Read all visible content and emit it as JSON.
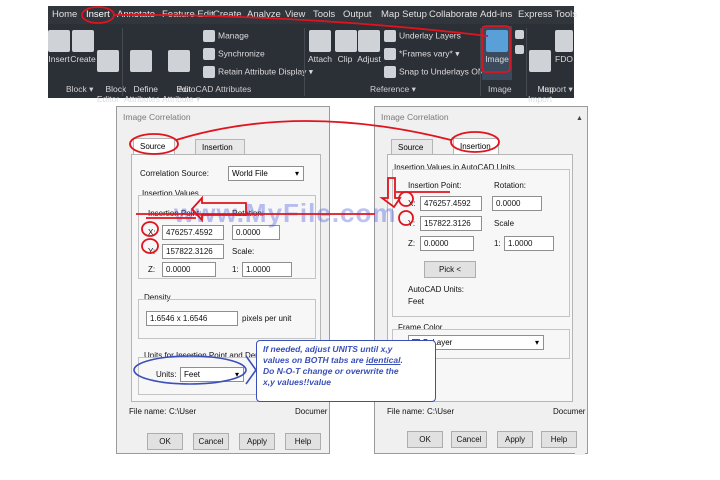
{
  "ribbon": {
    "tabs": [
      "Home",
      "Insert",
      "Annotate",
      "Feature Edit",
      "Create",
      "Analyze",
      "View",
      "Tools",
      "Output",
      "Map Setup",
      "Collaborate",
      "Add-ins",
      "Express Tools"
    ],
    "active_tab": "Insert",
    "block_tools": [
      "Insert",
      "Create",
      "Block\nEditor"
    ],
    "block_panel": "Block ▾",
    "define_attributes": "Define\nAttributes",
    "edit_attribute": "Edit\nAttribute ▾",
    "manage": "Manage",
    "synchronize": "Synchronize",
    "retain_attribute_display": "Retain Attribute Display ▾",
    "autocad_attributes_panel": "AutoCAD Attributes",
    "attach": "Attach",
    "clip": "Clip",
    "adjust": "Adjust",
    "underlay_layers": "Underlay Layers",
    "frames_vary": "*Frames vary* ▾",
    "snap_to_underlays": "Snap to Underlays ON ▾",
    "reference_panel": "Reference ▾",
    "image_button": "Image",
    "image_panel": "Image",
    "map_import": "Map\nImport",
    "fdo": "FDO",
    "import_panel": "Import ▾"
  },
  "left_dialog": {
    "title": "Image Correlation",
    "tabs": [
      "Source",
      "Insertion"
    ],
    "selected_tab": "Source",
    "correlation_source_label": "Correlation Source:",
    "correlation_source_value": "World File",
    "insertion_values_label": "Insertion Values",
    "insertion_point_label": "Insertion Point:",
    "rotation_label": "Rotation:",
    "x_label": "X:",
    "x_value": "476257.4592",
    "y_label": "Y:",
    "y_value": "157822.3126",
    "z_label": "Z:",
    "z_value": "0.0000",
    "rotation_value": "0.0000",
    "scale_label": "Scale:",
    "scale_prefix": "1:",
    "scale_value": "1.0000",
    "density_label": "Density",
    "density_value": "1.6546 x 1.6546",
    "density_units": "pixels per unit",
    "units_group_label": "Units for Insertion Point and Density",
    "units_label": "Units:",
    "units_value": "Feet",
    "file_name_label": "File name:",
    "file_name_value": "C:\\User",
    "file_name_tail": "Documer",
    "ok": "OK",
    "cancel": "Cancel",
    "apply": "Apply",
    "help": "Help"
  },
  "right_dialog": {
    "title": "Image Correlation",
    "tabs": [
      "Source",
      "Insertion"
    ],
    "selected_tab": "Insertion",
    "insertion_values_label": "Insertion Values in AutoCAD Units",
    "insertion_point_label": "Insertion Point:",
    "rotation_label": "Rotation:",
    "x_label": "X:",
    "x_value": "476257.4592",
    "rotation_value": "0.0000",
    "y_label": "Y:",
    "y_value": "157822.3126",
    "scale_label": "Scale",
    "z_label": "Z:",
    "z_value": "0.0000",
    "scale_prefix": "1:",
    "scale_value": "1.0000",
    "pick_button": "Pick <",
    "autocad_units_label": "AutoCAD Units:",
    "autocad_units_value": "Feet",
    "frame_color_label": "Frame Color",
    "frame_color_value": "ByLayer",
    "file_name_label": "File name:",
    "file_name_value": "C:\\User",
    "file_name_tail": "Documer",
    "ok": "OK",
    "cancel": "Cancel",
    "apply": "Apply",
    "help": "Help"
  },
  "note": {
    "line1": "If needed, adjust UNITS until x,y",
    "line2_a": "values on BOTH tabs are ",
    "line2_b": "identical",
    "line2_c": ".",
    "line3": "Do N-O-T change or overwrite the",
    "line4": "x,y values!!value"
  },
  "watermark": "www.MyFile.com",
  "colors": {
    "annotation_red": "#e0141e",
    "note_blue": "#3a4fb8",
    "ribbon_bg": "#2b2f36",
    "highlight_image": "#5aa0d8"
  }
}
